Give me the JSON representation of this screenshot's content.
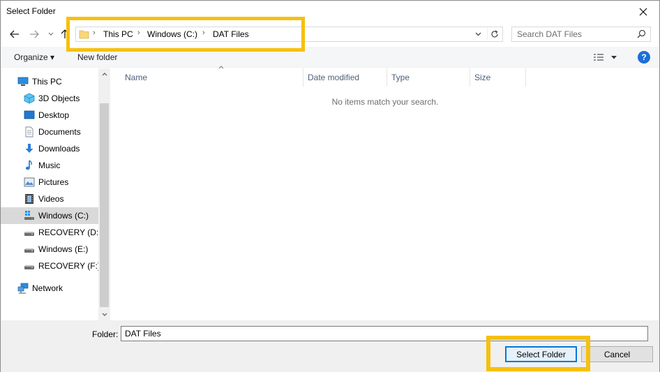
{
  "window": {
    "title": "Select Folder",
    "close_icon": "close-icon"
  },
  "nav": {
    "back_icon": "back-arrow-icon",
    "forward_icon": "forward-arrow-icon",
    "recent_icon": "chevron-down-icon",
    "up_icon": "up-arrow-icon"
  },
  "address": {
    "folder_icon": "folder-icon",
    "crumbs": [
      "This PC",
      "Windows (C:)",
      "DAT Files"
    ],
    "separator": "›"
  },
  "search": {
    "placeholder": "Search DAT Files"
  },
  "toolbar": {
    "organize_label": "Organize ▾",
    "new_folder_label": "New folder",
    "help_label": "?"
  },
  "sidebar": {
    "items": [
      {
        "label": "This PC",
        "icon": "computer-icon"
      },
      {
        "label": "3D Objects",
        "icon": "cube-icon"
      },
      {
        "label": "Desktop",
        "icon": "desktop-icon"
      },
      {
        "label": "Documents",
        "icon": "document-icon"
      },
      {
        "label": "Downloads",
        "icon": "download-icon"
      },
      {
        "label": "Music",
        "icon": "music-icon"
      },
      {
        "label": "Pictures",
        "icon": "picture-icon"
      },
      {
        "label": "Videos",
        "icon": "video-icon"
      },
      {
        "label": "Windows (C:)",
        "icon": "windows-drive-icon",
        "selected": true
      },
      {
        "label": "RECOVERY (D:)",
        "icon": "drive-icon"
      },
      {
        "label": "Windows (E:)",
        "icon": "drive-icon"
      },
      {
        "label": "RECOVERY (F:)",
        "icon": "drive-icon"
      },
      {
        "label": "Network",
        "icon": "network-icon"
      }
    ]
  },
  "content": {
    "columns": [
      "Name",
      "Date modified",
      "Type",
      "Size"
    ],
    "empty_message": "No items match your search."
  },
  "footer": {
    "folder_label": "Folder:",
    "folder_value": "DAT Files",
    "select_button": "Select Folder",
    "cancel_button": "Cancel"
  },
  "colors": {
    "highlight": "#f6c00e",
    "accent": "#0078d7",
    "selected_bg": "#d9d9d9"
  }
}
